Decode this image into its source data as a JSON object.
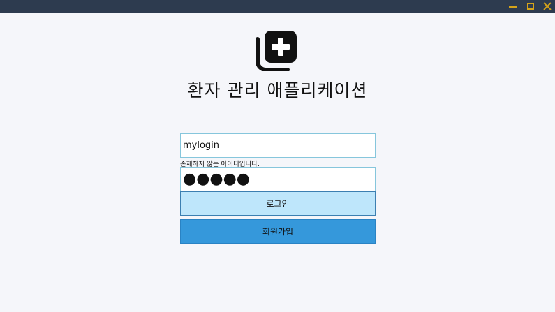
{
  "titlebar": {
    "minimize_icon": "minimize-icon",
    "maximize_icon": "maximize-icon",
    "close_icon": "close-icon",
    "background_color": "#2d3b4f",
    "icon_color": "#d4a31a"
  },
  "logo": {
    "icon": "medical-plus-icon"
  },
  "app_title": "환자 관리 애플리케이션",
  "login_form": {
    "id_value": "mylogin",
    "id_error": "존재하지 않는 아이디입니다.",
    "password_value": "●●●●●",
    "login_label": "로그인",
    "signup_label": "회원가입"
  },
  "colors": {
    "page_background": "#f5f6fa",
    "login_button": "#bee6fb",
    "signup_button": "#3598db",
    "input_border": "#86c6dc"
  }
}
